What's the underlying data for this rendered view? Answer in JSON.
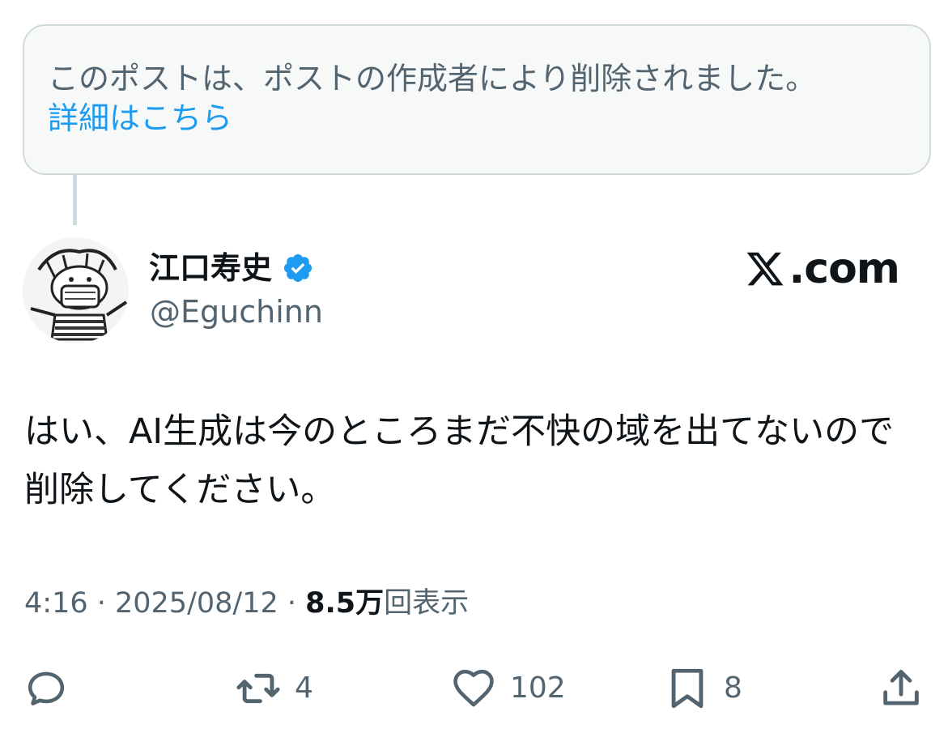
{
  "notice": {
    "text": "このポストは、ポストの作成者により削除されました。",
    "link": "詳細はこちら"
  },
  "author": {
    "display_name": "江口寿史",
    "handle": "@Eguchinn",
    "verified_icon": "verified-badge-icon",
    "avatar": "avatar-illustration"
  },
  "brand": {
    "icon": "x-logo-icon",
    "text": ".com"
  },
  "post": {
    "text": "はい、AI生成は今のところまだ不快の域を出てないので削除してください。"
  },
  "meta": {
    "time": "4:16",
    "date": "2025/08/12",
    "sep": " · ",
    "views_count": "8.5万",
    "views_label": "回表示"
  },
  "actions": {
    "reply": {
      "icon": "reply-icon",
      "count": ""
    },
    "repost": {
      "icon": "repost-icon",
      "count": "4"
    },
    "like": {
      "icon": "heart-icon",
      "count": "102"
    },
    "bookmark": {
      "icon": "bookmark-icon",
      "count": "8"
    },
    "share": {
      "icon": "share-icon",
      "count": ""
    }
  },
  "colors": {
    "link": "#1d9bf0",
    "secondary_text": "#536471",
    "primary_text": "#0f1419",
    "notice_bg": "#f7f9f9",
    "border": "#cfd9de"
  }
}
